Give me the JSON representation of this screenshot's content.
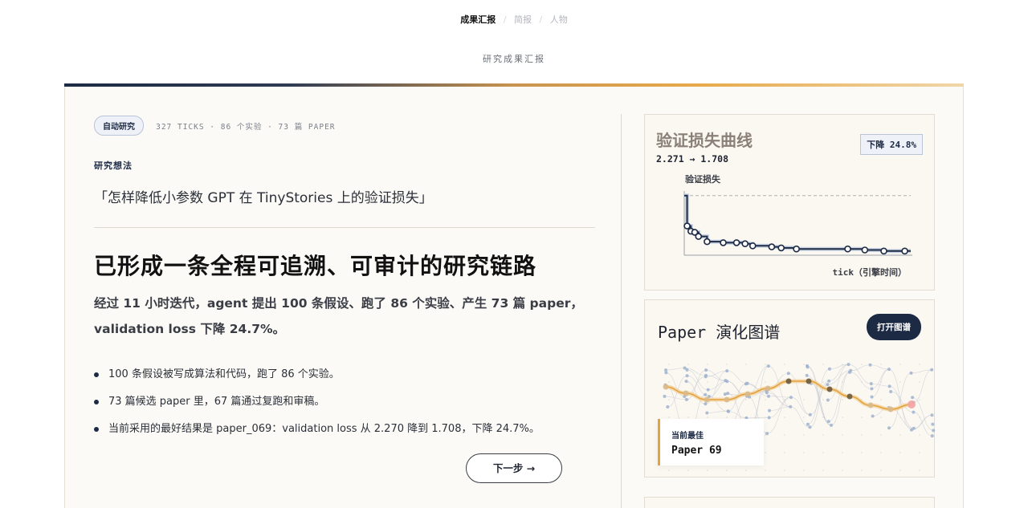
{
  "nav": {
    "active": "成果汇报",
    "items": [
      "简报",
      "人物"
    ],
    "separator": "/"
  },
  "page_subtitle": "研究成果汇报",
  "report": {
    "tag": "自动研究",
    "meta": "327 TICKS · 86 个实验 · 73 篇 PAPER",
    "idea_label": "研究想法",
    "idea_quote": "「怎样降低小参数 GPT 在 TinyStories 上的验证损失」",
    "headline": "已形成一条全程可追溯、可审计的研究链路",
    "lead_line1": "经过 11 小时迭代，agent 提出 100 条假设、跑了 86 个实验、产生 73 篇 paper，",
    "lead_line2": "validation loss 下降 24.7%。",
    "bullets": [
      "100 条假设被写成算法和代码，跑了 86 个实验。",
      "73 篇候选 paper 里，67 篇通过复跑和审稿。",
      "当前采用的最好结果是 paper_069：validation loss 从 2.270 降到 1.708，下降 24.7%。"
    ],
    "next_button": "下一步 →"
  },
  "loss_panel": {
    "title": "验证损失曲线",
    "range": "2.271 → 1.708",
    "badge": "下降 24.8%",
    "ylabel": "验证损失",
    "xlabel": "tick（引擎时间）"
  },
  "chart_data": {
    "type": "line",
    "title": "验证损失曲线",
    "xlabel": "tick（引擎时间）",
    "ylabel": "验证损失",
    "step": true,
    "baseline": 2.271,
    "final": 1.708,
    "series": [
      {
        "x": [
          0,
          3,
          7,
          11,
          15,
          24,
          41,
          55,
          64,
          72,
          92,
          102,
          118,
          172,
          190,
          210,
          232
        ],
        "y": [
          2.271,
          1.98,
          1.93,
          1.92,
          1.88,
          1.83,
          1.82,
          1.82,
          1.81,
          1.79,
          1.78,
          1.77,
          1.76,
          1.76,
          1.75,
          1.74,
          1.74
        ],
        "markers": [
          false,
          true,
          true,
          true,
          true,
          true,
          true,
          true,
          true,
          true,
          true,
          true,
          true,
          true,
          true,
          true,
          true
        ]
      }
    ],
    "colors": {
      "line": "#1d2a44",
      "baseline": "#b0b0b0"
    }
  },
  "graph_panel": {
    "title": "Paper 演化图谱",
    "open_button": "打开图谱",
    "best_label": "当前最佳",
    "best_value": "Paper 69"
  },
  "colors": {
    "accent_navy": "#1d2a44",
    "accent_gold": "#e3a23a",
    "best_red": "#e05a5a"
  }
}
